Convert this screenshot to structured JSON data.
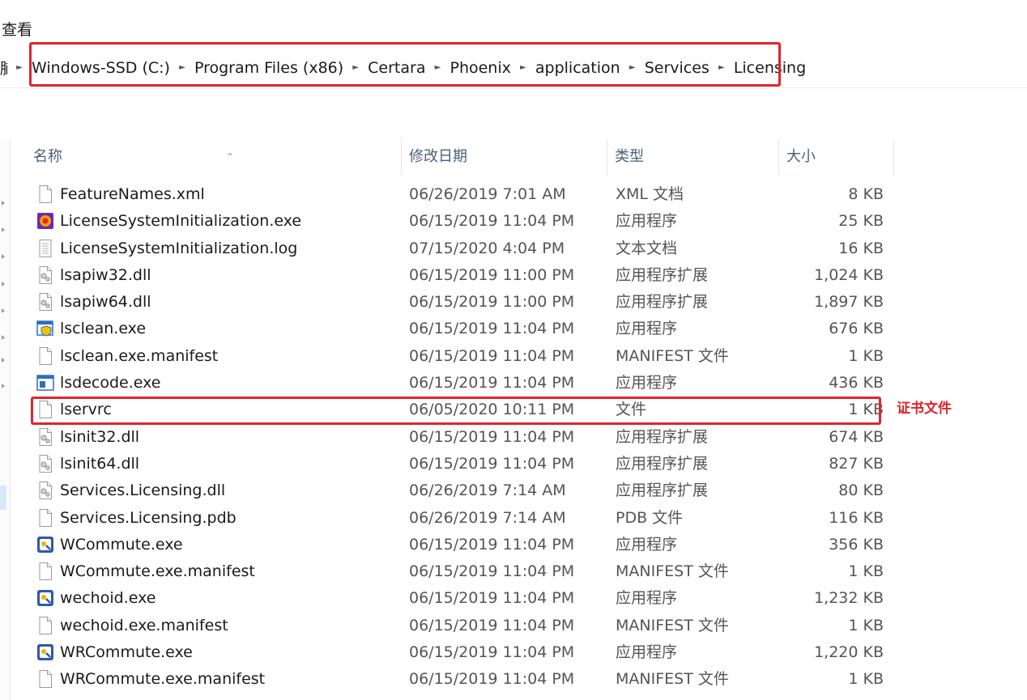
{
  "menu": {
    "view_label": "查看"
  },
  "address_bar": {
    "prefix_fragment": "脑",
    "crumbs": [
      "Windows-SSD (C:)",
      "Program Files (x86)",
      "Certara",
      "Phoenix",
      "application",
      "Services",
      "Licensing"
    ]
  },
  "columns": {
    "name": "名称",
    "date": "修改日期",
    "type": "类型",
    "size": "大小"
  },
  "annotation": {
    "text": "证书文件",
    "color": "#e0242b"
  },
  "files": [
    {
      "name": "FeatureNames.xml",
      "date": "06/26/2019 7:01 AM",
      "type": "XML 文档",
      "size": "8 KB",
      "icon": "xml-file-icon"
    },
    {
      "name": "LicenseSystemInitialization.exe",
      "date": "06/15/2019 11:04 PM",
      "type": "应用程序",
      "size": "25 KB",
      "icon": "app-exe-icon"
    },
    {
      "name": "LicenseSystemInitialization.log",
      "date": "07/15/2020 4:04 PM",
      "type": "文本文档",
      "size": "16 KB",
      "icon": "text-file-icon"
    },
    {
      "name": "lsapiw32.dll",
      "date": "06/15/2019 11:00 PM",
      "type": "应用程序扩展",
      "size": "1,024 KB",
      "icon": "dll-file-icon"
    },
    {
      "name": "lsapiw64.dll",
      "date": "06/15/2019 11:00 PM",
      "type": "应用程序扩展",
      "size": "1,897 KB",
      "icon": "dll-file-icon"
    },
    {
      "name": "lsclean.exe",
      "date": "06/15/2019 11:04 PM",
      "type": "应用程序",
      "size": "676 KB",
      "icon": "shield-exe-icon"
    },
    {
      "name": "lsclean.exe.manifest",
      "date": "06/15/2019 11:04 PM",
      "type": "MANIFEST 文件",
      "size": "1 KB",
      "icon": "blank-file-icon"
    },
    {
      "name": "lsdecode.exe",
      "date": "06/15/2019 11:04 PM",
      "type": "应用程序",
      "size": "436 KB",
      "icon": "window-exe-icon"
    },
    {
      "name": "lservrc",
      "date": "06/05/2020 10:11 PM",
      "type": "文件",
      "size": "1 KB",
      "icon": "blank-file-icon"
    },
    {
      "name": "lsinit32.dll",
      "date": "06/15/2019 11:04 PM",
      "type": "应用程序扩展",
      "size": "674 KB",
      "icon": "dll-file-icon"
    },
    {
      "name": "lsinit64.dll",
      "date": "06/15/2019 11:04 PM",
      "type": "应用程序扩展",
      "size": "827 KB",
      "icon": "dll-file-icon"
    },
    {
      "name": "Services.Licensing.dll",
      "date": "06/26/2019 7:14 AM",
      "type": "应用程序扩展",
      "size": "80 KB",
      "icon": "dll-file-icon"
    },
    {
      "name": "Services.Licensing.pdb",
      "date": "06/26/2019 7:14 AM",
      "type": "PDB 文件",
      "size": "116 KB",
      "icon": "blank-file-icon"
    },
    {
      "name": "WCommute.exe",
      "date": "06/15/2019 11:04 PM",
      "type": "应用程序",
      "size": "356 KB",
      "icon": "commute-exe-icon"
    },
    {
      "name": "WCommute.exe.manifest",
      "date": "06/15/2019 11:04 PM",
      "type": "MANIFEST 文件",
      "size": "1 KB",
      "icon": "blank-file-icon"
    },
    {
      "name": "wechoid.exe",
      "date": "06/15/2019 11:04 PM",
      "type": "应用程序",
      "size": "1,232 KB",
      "icon": "commute-exe-icon"
    },
    {
      "name": "wechoid.exe.manifest",
      "date": "06/15/2019 11:04 PM",
      "type": "MANIFEST 文件",
      "size": "1 KB",
      "icon": "blank-file-icon"
    },
    {
      "name": "WRCommute.exe",
      "date": "06/15/2019 11:04 PM",
      "type": "应用程序",
      "size": "1,220 KB",
      "icon": "commute-exe-icon"
    },
    {
      "name": "WRCommute.exe.manifest",
      "date": "06/15/2019 11:04 PM",
      "type": "MANIFEST 文件",
      "size": "1 KB",
      "icon": "blank-file-icon"
    }
  ]
}
